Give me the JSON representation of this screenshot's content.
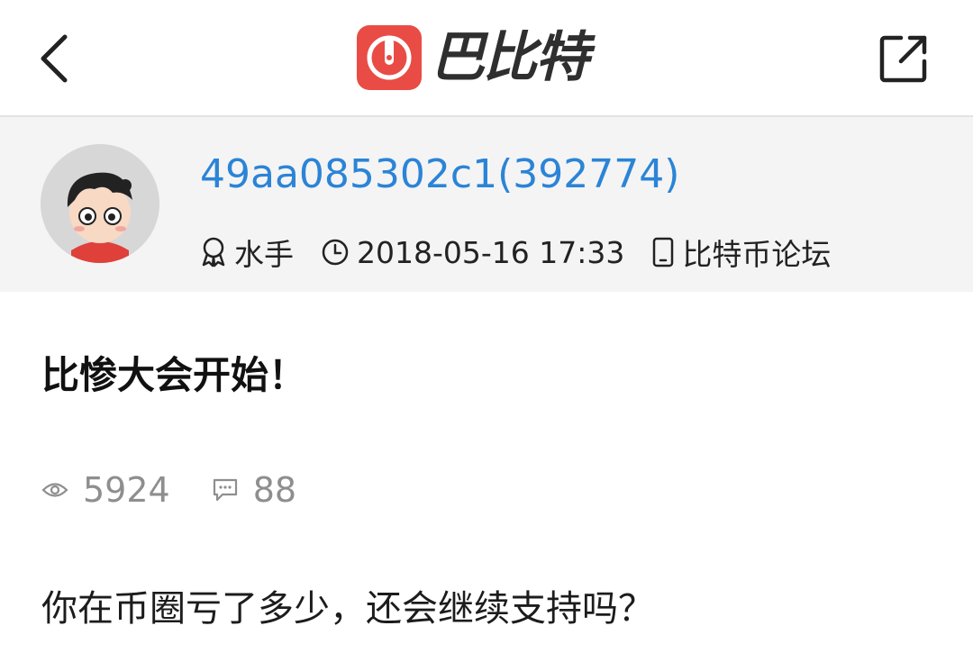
{
  "header": {
    "logo_text": "巴比特",
    "back_icon": "chevron-left-icon",
    "share_icon": "share-external-icon",
    "brand_color": "#e94c45"
  },
  "author": {
    "name": "49aa085302c1(392774)",
    "rank": "水手",
    "datetime": "2018-05-16 17:33",
    "forum": "比特币论坛",
    "name_color": "#2b84d6"
  },
  "post": {
    "title": "比惨大会开始！",
    "views": "5924",
    "comments": "88",
    "body": "你在币圈亏了多少，还会继续支持吗？"
  }
}
